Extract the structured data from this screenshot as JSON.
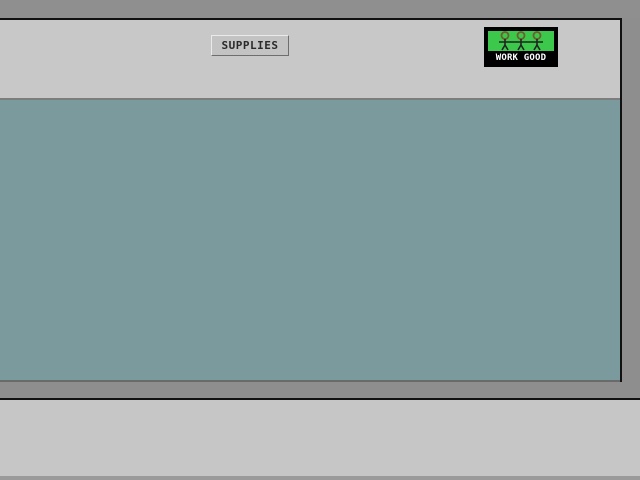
{
  "toolbar": {
    "supplies_label": "SUPPLIES"
  },
  "badge": {
    "text": "WORK GOOD",
    "icon": "three-workers-holding-hands-icon",
    "color_background": "#3cc84a",
    "color_figures": "#7a6a3a"
  },
  "colors": {
    "work_area": "#7a9a9e",
    "panel": "#c6c6c6",
    "frame": "#8e8e8e"
  }
}
